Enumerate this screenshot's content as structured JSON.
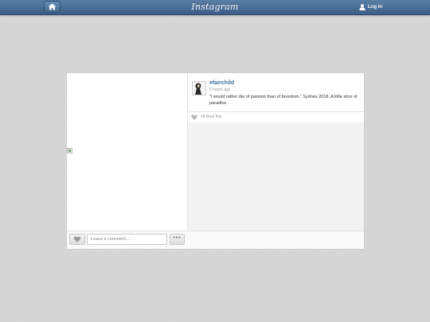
{
  "header": {
    "logo": "Instagram",
    "login_label": "Log in",
    "home_icon": "home-icon",
    "user_icon": "user-icon"
  },
  "post": {
    "username": "efairchild",
    "timestamp": "5 hours ago",
    "caption": "\"I would rather die of passion than of boredom.\" Sydney 2018. A little slice of paradise.",
    "likes": "48 liked this."
  },
  "actions": {
    "comment_placeholder": "Leave a comment...",
    "more_label": "•••",
    "like_icon": "heart-icon"
  },
  "colors": {
    "header_blue": "#3a5e88",
    "username_blue": "#3f729b",
    "page_background": "#d5d5d5"
  }
}
